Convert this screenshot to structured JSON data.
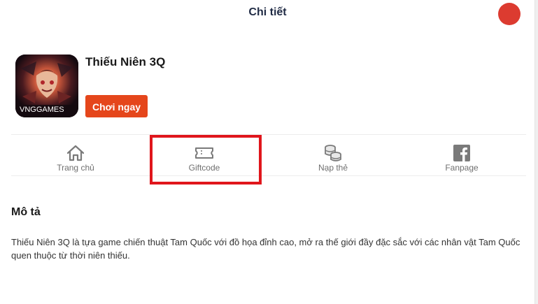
{
  "header": {
    "title": "Chi tiết"
  },
  "app": {
    "name": "Thiếu Niên 3Q",
    "icon_brand_text": "VNGGAMES",
    "play_label": "Chơi ngay"
  },
  "nav": {
    "items": [
      {
        "label": "Trang chủ",
        "icon": "home-icon"
      },
      {
        "label": "Giftcode",
        "icon": "ticket-icon"
      },
      {
        "label": "Nạp thẻ",
        "icon": "coins-icon"
      },
      {
        "label": "Fanpage",
        "icon": "facebook-icon"
      }
    ],
    "highlighted": "Giftcode"
  },
  "description": {
    "heading": "Mô tả",
    "text": "Thiếu Niên 3Q là tựa game chiến thuật Tam Quốc với đồ họa đỉnh cao, mở ra thế giới đầy đặc sắc với các nhân vật Tam Quốc quen thuộc từ thời niên thiếu."
  },
  "colors": {
    "accent": "#e5461b",
    "header_dot": "#dc3b30",
    "highlight_border": "#e0161c",
    "nav_icon": "#7a7a7a"
  }
}
